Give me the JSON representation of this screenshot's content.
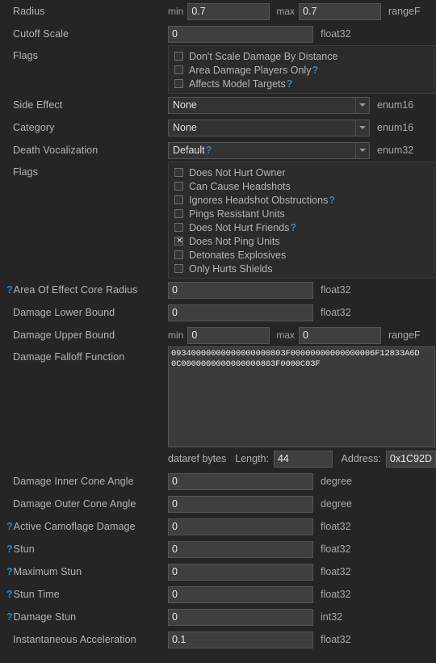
{
  "theme": {
    "background": "#252526",
    "field_background": "#3f3f3f",
    "field_border": "#555556",
    "label_color": "#b4b4b4",
    "accent_help": "#1e8ad6"
  },
  "rows": [
    {
      "id": "radius",
      "label": "Radius",
      "help": false,
      "kind": "range",
      "min_label": "min",
      "min_value": "0.7",
      "max_label": "max",
      "max_value": "0.7",
      "type": "rangeF"
    },
    {
      "id": "cutoff-scale",
      "label": "Cutoff Scale",
      "help": false,
      "kind": "input",
      "value": "0",
      "type": "float32"
    },
    {
      "id": "flags-1",
      "label": "Flags",
      "help": false,
      "kind": "flags",
      "flags": [
        {
          "label": "Don't Scale Damage By Distance",
          "checked": false,
          "help": false
        },
        {
          "label": "Area Damage Players Only",
          "checked": false,
          "help": true
        },
        {
          "label": "Affects Model Targets",
          "checked": false,
          "help": true
        }
      ]
    },
    {
      "id": "side-effect",
      "label": "Side Effect",
      "help": false,
      "kind": "combo",
      "value": "None",
      "value_help": false,
      "type": "enum16"
    },
    {
      "id": "category",
      "label": "Category",
      "help": false,
      "kind": "combo",
      "value": "None",
      "value_help": false,
      "type": "enum16"
    },
    {
      "id": "death-vocalization",
      "label": "Death Vocalization",
      "help": false,
      "kind": "combo",
      "value": "Default",
      "value_help": true,
      "type": "enum32"
    },
    {
      "id": "flags-2",
      "label": "Flags",
      "help": false,
      "kind": "flags",
      "flags": [
        {
          "label": "Does Not Hurt Owner",
          "checked": false,
          "help": false
        },
        {
          "label": "Can Cause Headshots",
          "checked": false,
          "help": false
        },
        {
          "label": "Ignores Headshot Obstructions",
          "checked": false,
          "help": true
        },
        {
          "label": "Pings Resistant Units",
          "checked": false,
          "help": false
        },
        {
          "label": "Does Not Hurt Friends",
          "checked": false,
          "help": true
        },
        {
          "label": "Does Not Ping Units",
          "checked": true,
          "help": false
        },
        {
          "label": "Detonates Explosives",
          "checked": false,
          "help": false
        },
        {
          "label": "Only Hurts Shields",
          "checked": false,
          "help": false
        }
      ]
    },
    {
      "id": "area-of-effect-core-radius",
      "label": "Area Of Effect Core Radius",
      "help": true,
      "kind": "input",
      "value": "0",
      "type": "float32"
    },
    {
      "id": "damage-lower-bound",
      "label": "Damage Lower Bound",
      "help": false,
      "kind": "input",
      "value": "0",
      "type": "float32"
    },
    {
      "id": "damage-upper-bound",
      "label": "Damage Upper Bound",
      "help": false,
      "kind": "range",
      "min_label": "min",
      "min_value": "0",
      "max_label": "max",
      "max_value": "0",
      "type": "rangeF"
    },
    {
      "id": "damage-falloff-function",
      "label": "Damage Falloff Function",
      "help": false,
      "kind": "hex",
      "hex_lines": [
        "09340000000000000000803F00000000000000006F12833A6D",
        "0C0000000000000000803F0000C03F"
      ],
      "meta": {
        "caption": "dataref bytes",
        "length_label": "Length:",
        "length_value": "44",
        "address_label": "Address:",
        "address_value": "0x1C92D"
      }
    },
    {
      "id": "damage-inner-cone-angle",
      "label": "Damage Inner Cone Angle",
      "help": false,
      "kind": "input",
      "value": "0",
      "type": "degree"
    },
    {
      "id": "damage-outer-cone-angle",
      "label": "Damage Outer Cone Angle",
      "help": false,
      "kind": "input",
      "value": "0",
      "type": "degree"
    },
    {
      "id": "active-camoflage-damage",
      "label": "Active Camoflage Damage",
      "help": true,
      "kind": "input",
      "value": "0",
      "type": "float32"
    },
    {
      "id": "stun",
      "label": "Stun",
      "help": true,
      "kind": "input",
      "value": "0",
      "type": "float32"
    },
    {
      "id": "maximum-stun",
      "label": "Maximum Stun",
      "help": true,
      "kind": "input",
      "value": "0",
      "type": "float32"
    },
    {
      "id": "stun-time",
      "label": "Stun Time",
      "help": true,
      "kind": "input",
      "value": "0",
      "type": "float32"
    },
    {
      "id": "damage-stun",
      "label": "Damage Stun",
      "help": true,
      "kind": "input",
      "value": "0",
      "type": "int32"
    },
    {
      "id": "instantaneous-acceleration",
      "label": "Instantaneous Acceleration",
      "help": false,
      "kind": "input",
      "value": "0.1",
      "type": "float32"
    }
  ]
}
